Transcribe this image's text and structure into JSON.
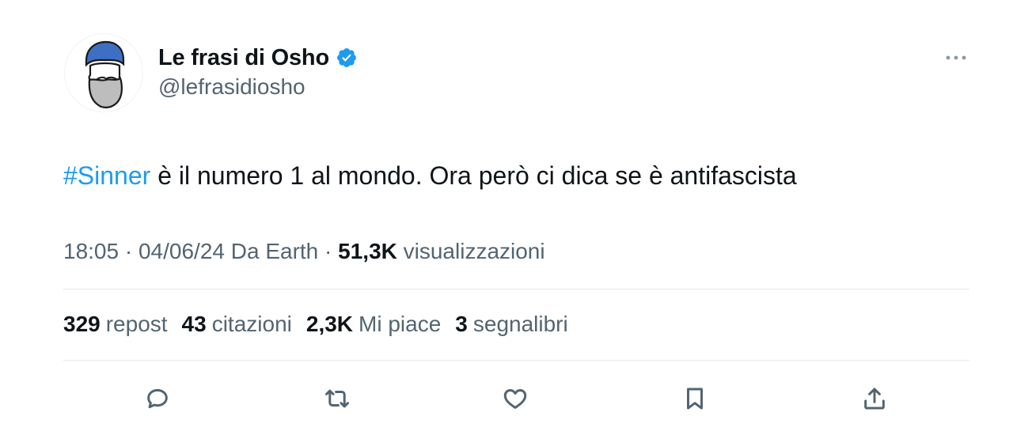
{
  "author": {
    "display_name": "Le frasi di Osho",
    "handle": "@lefrasidiosho",
    "verified_icon": "verified-badge-icon",
    "avatar_icon": "bearded-man-avatar"
  },
  "tweet": {
    "hashtag": "#Sinner",
    "text": " è il numero 1 al mondo. Ora però ci dica se è antifascista"
  },
  "meta": {
    "time": "18:05",
    "separator1": " · ",
    "date": "04/06/24",
    "source": " Da Earth",
    "separator2": " · ",
    "views_count": "51,3K",
    "views_label": " visualizzazioni"
  },
  "stats": [
    {
      "count": "329",
      "label": "repost"
    },
    {
      "count": "43",
      "label": "citazioni"
    },
    {
      "count": "2,3K",
      "label": "Mi piace"
    },
    {
      "count": "3",
      "label": "segnalibri"
    }
  ],
  "actions": [
    "reply-icon",
    "retweet-icon",
    "like-icon",
    "bookmark-icon",
    "share-icon"
  ],
  "colors": {
    "accent": "#1d9bf0",
    "text_primary": "#0f1419",
    "text_secondary": "#536471",
    "divider": "#e1e8ed"
  }
}
